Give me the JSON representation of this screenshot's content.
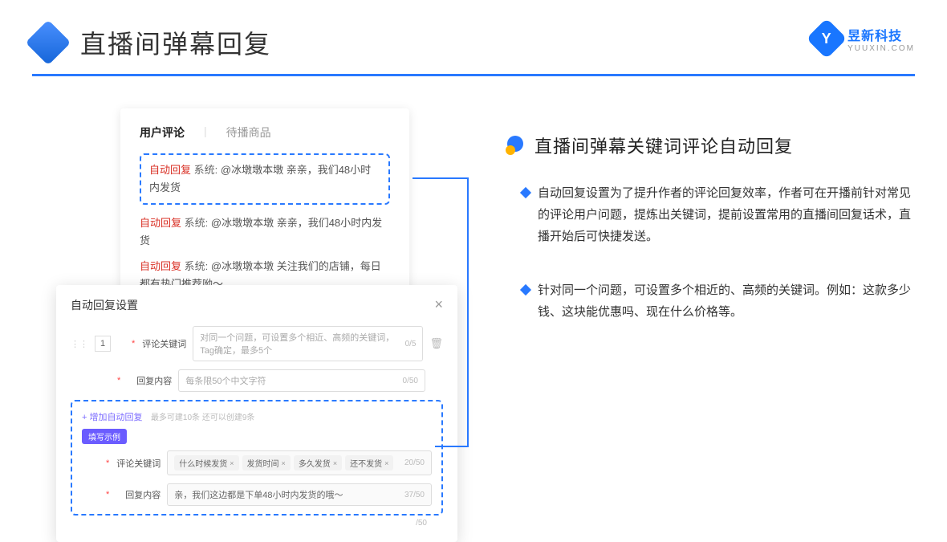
{
  "header": {
    "title": "直播间弹幕回复"
  },
  "brand": {
    "name": "昱新科技",
    "sub": "YUUXIN.COM",
    "letter": "Y"
  },
  "comments": {
    "tab_active": "用户评论",
    "tab_inactive": "待播商品",
    "auto_label": "自动回复",
    "sys_label": "系统:",
    "line1": "@冰墩墩本墩 亲亲，我们48小时内发货",
    "line2": "@冰墩墩本墩 亲亲，我们48小时内发货",
    "line3": "@冰墩墩本墩 关注我们的店铺，每日都有热门推荐呦～"
  },
  "settings": {
    "title": "自动回复设置",
    "row_num": "1",
    "kw_label": "评论关键词",
    "kw_placeholder": "对同一个问题，可设置多个相近、高频的关键词，Tag确定，最多5个",
    "kw_counter": "0/5",
    "content_label": "回复内容",
    "content_placeholder": "每条限50个中文字符",
    "content_counter": "0/50",
    "add_link": "+ 增加自动回复",
    "add_hint": "最多可建10条 还可以创建9条",
    "example_badge": "填写示例",
    "example_kw_label": "评论关键词",
    "example_tags": [
      "什么时候发货",
      "发货时间",
      "多久发货",
      "还不发货"
    ],
    "example_kw_counter": "20/50",
    "example_content_label": "回复内容",
    "example_content": "亲，我们这边都是下单48小时内发货的哦～",
    "example_content_counter": "37/50",
    "outer_counter": "/50"
  },
  "right": {
    "title": "直播间弹幕关键词评论自动回复",
    "p1": "自动回复设置为了提升作者的评论回复效率，作者可在开播前针对常见的评论用户问题，提炼出关键词，提前设置常用的直播间回复话术，直播开始后可快捷发送。",
    "p2": "针对同一个问题，可设置多个相近的、高频的关键词。例如：这款多少钱、这块能优惠吗、现在什么价格等。"
  }
}
